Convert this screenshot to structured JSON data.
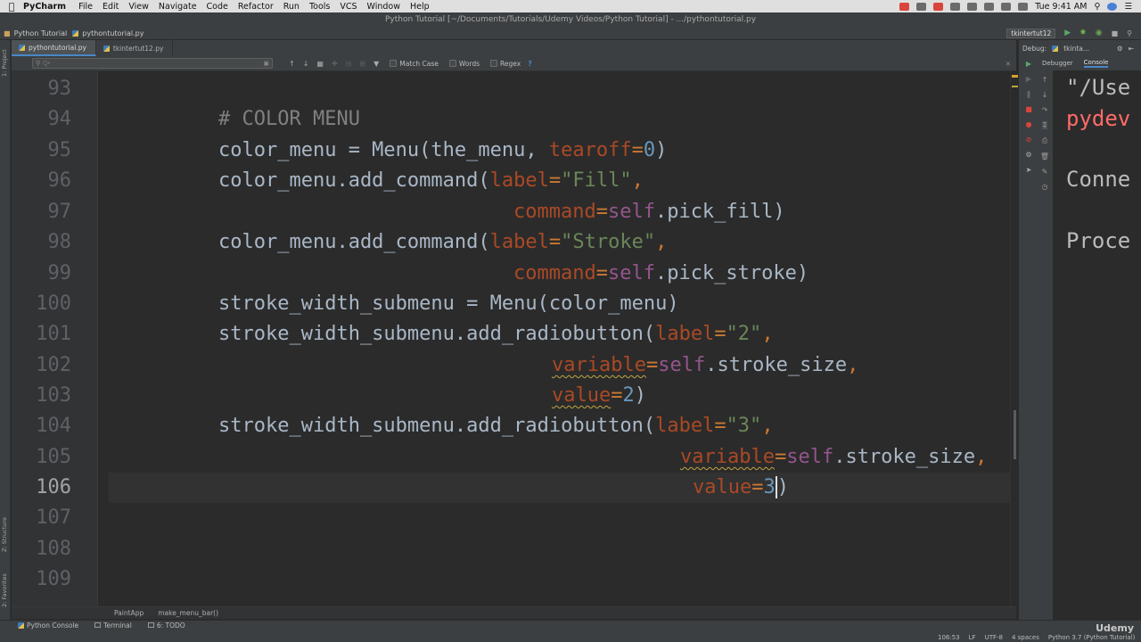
{
  "menubar": {
    "app_name": "PyCharm",
    "items": [
      "File",
      "Edit",
      "View",
      "Navigate",
      "Code",
      "Refactor",
      "Run",
      "Tools",
      "VCS",
      "Window",
      "Help"
    ],
    "clock": "Tue 9:41 AM"
  },
  "window": {
    "title": "Python Tutorial [~/Documents/Tutorials/Udemy Videos/Python Tutorial] - .../pythontutorial.py"
  },
  "navbar": {
    "project": "Python Tutorial",
    "file": "pythontutorial.py",
    "run_config": "tkintertut12"
  },
  "tabs": [
    {
      "label": "pythontutorial.py",
      "active": true
    },
    {
      "label": "tkintertut12.py",
      "active": false
    }
  ],
  "search": {
    "placeholder": "Q•",
    "value": "",
    "match_case": "Match Case",
    "words": "Words",
    "regex": "Regex",
    "help": "?"
  },
  "left_tools": {
    "project": "1: Project",
    "structure": "Z: Structure",
    "favorites": "2: Favorites"
  },
  "editor": {
    "line_numbers": [
      "93",
      "94",
      "95",
      "96",
      "97",
      "98",
      "99",
      "100",
      "101",
      "102",
      "103",
      "104",
      "105",
      "106",
      "107",
      "108",
      "109"
    ],
    "current_line": "106",
    "code": {
      "l94": "# COLOR MENU",
      "l95a": "color_menu = Menu(the_menu, ",
      "l95b": "tearoff",
      "l95c": "=",
      "l95d": "0",
      "l95e": ")",
      "l96a": "color_menu.add_command(",
      "l96b": "label",
      "l96c": "=",
      "l96d": "\"Fill\"",
      "l96e": ",",
      "l97a": "command",
      "l97b": "=",
      "l97c": "self",
      "l97d": ".pick_fill)",
      "l98a": "color_menu.add_command(",
      "l98b": "label",
      "l98c": "=",
      "l98d": "\"Stroke\"",
      "l98e": ",",
      "l99a": "command",
      "l99b": "=",
      "l99c": "self",
      "l99d": ".pick_stroke)",
      "l100": "stroke_width_submenu = Menu(color_menu)",
      "l101a": "stroke_width_submenu.add_radiobutton(",
      "l101b": "label",
      "l101c": "=",
      "l101d": "\"2\"",
      "l101e": ",",
      "l102a": "variable",
      "l102b": "=",
      "l102c": "self",
      "l102d": ".stroke_size",
      "l102e": ",",
      "l103a": "value",
      "l103b": "=",
      "l103c": "2",
      "l103d": ")",
      "l104a": "stroke_width_submenu.add_radiobutton(",
      "l104b": "label",
      "l104c": "=",
      "l104d": "\"3\"",
      "l104e": ",",
      "l105a": "variable",
      "l105b": "=",
      "l105c": "self",
      "l105d": ".stroke_size",
      "l105e": ",",
      "l106a": "value",
      "l106b": "=",
      "l106c": "3",
      "l106d": ")"
    }
  },
  "breadcrumb": [
    "PaintApp",
    "make_menu_bar()"
  ],
  "debug": {
    "label": "Debug:",
    "config": "tkinta...",
    "tab_debugger": "Debugger",
    "tab_console": "Console",
    "console_lines": [
      "\"/Use",
      "pydev",
      "Conne",
      "Proce"
    ]
  },
  "statusbar": {
    "python_console": "Python Console",
    "terminal": "Terminal",
    "todo": "6: TODO",
    "position": "106:53",
    "line_sep": "LF",
    "encoding": "UTF-8",
    "indent": "4 spaces",
    "interpreter": "Python 3.7 (Python Tutorial)",
    "watermark": "Udemy"
  },
  "colors": {
    "editor_bg": "#2b2b2b",
    "keyword": "#cc7832",
    "param": "#aa4926",
    "string": "#6a8759",
    "number": "#6897bb",
    "self": "#94558d",
    "comment": "#808080",
    "text": "#a9b7c6"
  }
}
